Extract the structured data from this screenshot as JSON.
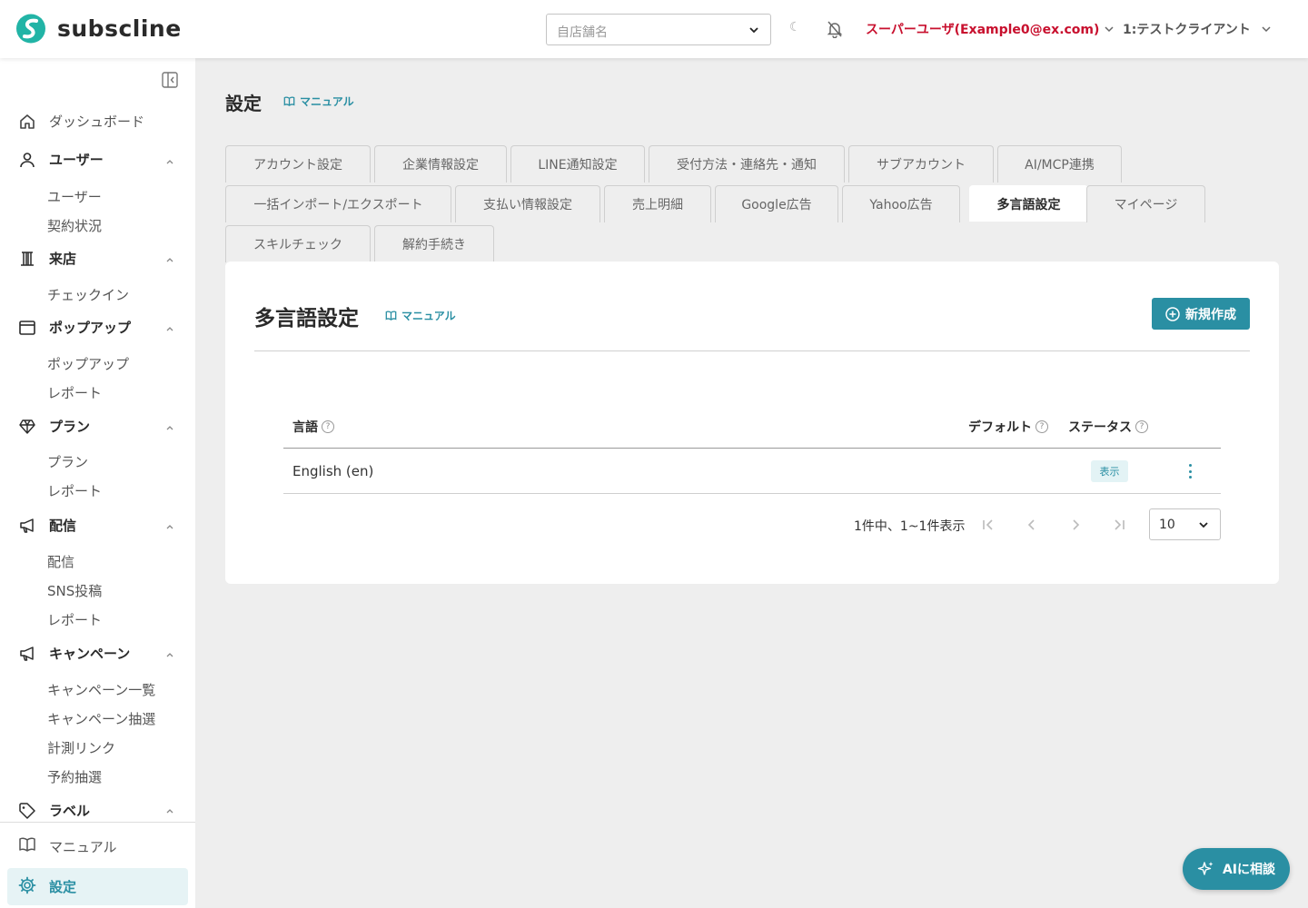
{
  "app": {
    "logo_text": "subscline",
    "brand_color": "#2a8fa3",
    "user_color": "#c8102e"
  },
  "header": {
    "store_placeholder": "自店舗名",
    "theme_icon": "moon-icon",
    "notification_icon": "bell-off-icon",
    "user_label": "スーパーユーザ(Example0@ex.com)",
    "client_label": "1:テストクライアント"
  },
  "sidebar": {
    "items": [
      {
        "label": "ダッシュボード",
        "icon": "home-icon"
      },
      {
        "label": "ユーザー",
        "icon": "user-icon",
        "children": [
          "ユーザー",
          "契約状況"
        ]
      },
      {
        "label": "来店",
        "icon": "building-icon",
        "children": [
          "チェックイン"
        ]
      },
      {
        "label": "ポップアップ",
        "icon": "window-icon",
        "children": [
          "ポップアップ",
          "レポート"
        ]
      },
      {
        "label": "プラン",
        "icon": "diamond-icon",
        "children": [
          "プラン",
          "レポート"
        ]
      },
      {
        "label": "配信",
        "icon": "megaphone-icon",
        "children": [
          "配信",
          "SNS投稿",
          "レポート"
        ]
      },
      {
        "label": "キャンペーン",
        "icon": "megaphone-icon",
        "children": [
          "キャンペーン一覧",
          "キャンペーン抽選",
          "計測リンク",
          "予約抽選"
        ]
      },
      {
        "label": "ラベル",
        "icon": "tag-icon"
      }
    ],
    "footer": [
      {
        "label": "マニュアル",
        "icon": "book-icon"
      },
      {
        "label": "設定",
        "icon": "gear-icon"
      }
    ]
  },
  "page": {
    "title": "設定",
    "manual_label": "マニュアル"
  },
  "tabs": {
    "row1": [
      "アカウント設定",
      "企業情報設定",
      "LINE通知設定",
      "受付方法・連絡先・通知",
      "サブアカウント",
      "AI/MCP連携"
    ],
    "row2": [
      "一括インポート/エクスポート",
      "支払い情報設定",
      "売上明細",
      "Google広告",
      "Yahoo広告",
      "多言語設定",
      "マイページ"
    ],
    "row3": [
      "スキルチェック",
      "解約手続き"
    ],
    "active": "多言語設定"
  },
  "card": {
    "title": "多言語設定",
    "manual_label": "マニュアル",
    "new_button": "新規作成",
    "columns": [
      "言語",
      "デフォルト",
      "ステータス"
    ],
    "rows": [
      {
        "language": "English (en)",
        "default": "",
        "status": "表示"
      }
    ],
    "pagination": {
      "info": "1件中、1~1件表示",
      "per_page": "10"
    }
  },
  "ai_button": "AIに相談"
}
